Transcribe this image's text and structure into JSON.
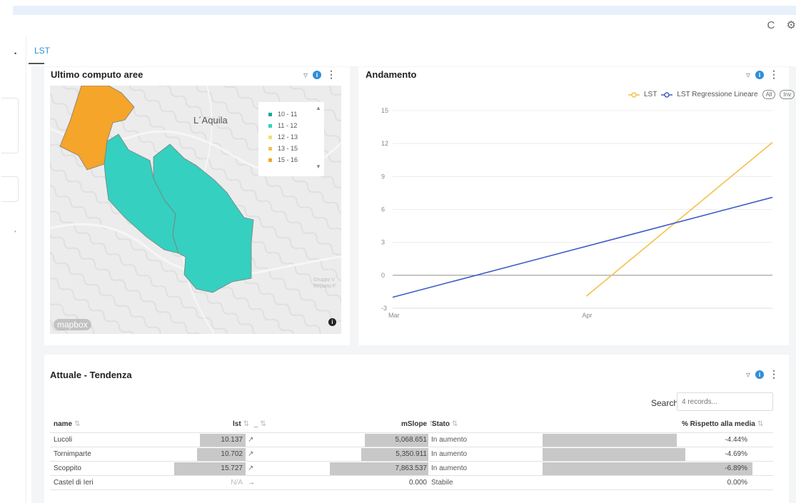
{
  "header": {
    "refresh_icon": "C",
    "settings_icon": "⚙"
  },
  "tabs": [
    {
      "label": "LST"
    }
  ],
  "map_card": {
    "title": "Ultimo computo aree",
    "city_label": "L´Aquila",
    "credit": "Gruppo V\nReparto F",
    "logo_text": "mapbox",
    "legend": [
      {
        "label": "10 - 11",
        "color": "#18a89a"
      },
      {
        "label": "11 - 12",
        "color": "#35d0c0"
      },
      {
        "label": "12 - 13",
        "color": "#f2e06a"
      },
      {
        "label": "13 - 15",
        "color": "#f3c14a"
      },
      {
        "label": "15 - 16",
        "color": "#f4a52a"
      }
    ]
  },
  "chart_card": {
    "title": "Andamento",
    "legend_all": "All",
    "legend_inv": "Inv",
    "chart_data": {
      "type": "line",
      "x": [
        "Mar",
        "Apr"
      ],
      "ylim": [
        -3,
        15
      ],
      "yticks": [
        -3,
        0,
        3,
        6,
        9,
        12,
        15
      ],
      "series": [
        {
          "name": "LST",
          "color": "#f3c14a",
          "points": [
            [
              0.51,
              -1.9
            ],
            [
              1.0,
              12.1
            ]
          ]
        },
        {
          "name": "LST Regressione Lineare",
          "color": "#3f5ec8",
          "points": [
            [
              0.0,
              -2.0
            ],
            [
              1.0,
              7.1
            ]
          ]
        }
      ],
      "grid": true
    }
  },
  "table_card": {
    "title": "Attuale - Tendenza",
    "search_label": "Search",
    "search_placeholder": "4 records...",
    "headers": {
      "name": "name",
      "lst": "lst",
      "trend": "_",
      "mslope": "mSlope",
      "stato": "Stato",
      "rispetto": "% Rispetto alla media"
    },
    "rows": [
      {
        "name": "Lucoli",
        "lst": "10.137",
        "trend": "↗",
        "mslope": "5,068.651",
        "stato": "In aumento",
        "rispetto": "-4.44%",
        "lst_frac": 0.645,
        "mslope_frac": 0.645,
        "rispetto_frac": 0.64
      },
      {
        "name": "Tornimparte",
        "lst": "10.702",
        "trend": "↗",
        "mslope": "5,350.911",
        "stato": "In aumento",
        "rispetto": "-4.69%",
        "lst_frac": 0.68,
        "mslope_frac": 0.68,
        "rispetto_frac": 0.68
      },
      {
        "name": "Scoppito",
        "lst": "15.727",
        "trend": "↗",
        "mslope": "7,863.537",
        "stato": "In aumento",
        "rispetto": "-6.89%",
        "lst_frac": 1.0,
        "mslope_frac": 1.0,
        "rispetto_frac": 1.0
      },
      {
        "name": "Castel di Ieri",
        "lst": "N/A",
        "trend": "→",
        "mslope": "0.000",
        "stato": "Stabile",
        "rispetto": "0.00%",
        "lst_frac": 0,
        "mslope_frac": 0,
        "rispetto_frac": 0
      }
    ]
  }
}
